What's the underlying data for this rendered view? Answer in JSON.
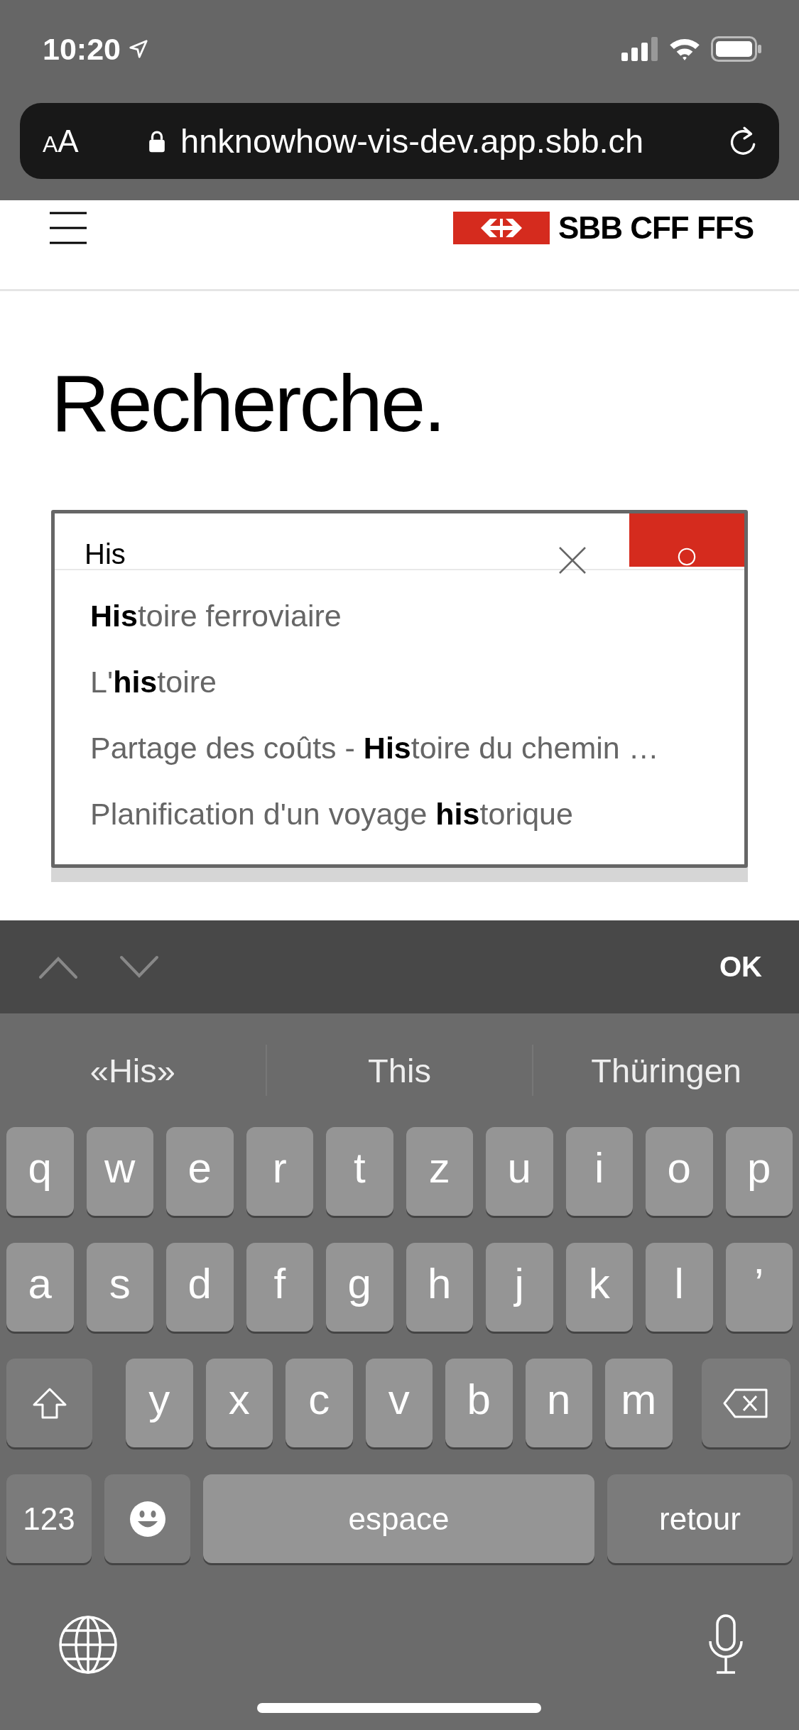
{
  "status_bar": {
    "time": "10:20"
  },
  "browser": {
    "text_size": {
      "small": "A",
      "large": "A"
    },
    "url": "hnknowhow-vis-dev.app.sbb.ch"
  },
  "header": {
    "logo_text": "SBB CFF FFS"
  },
  "page_title": "Recherche.",
  "search": {
    "value": "His",
    "suggestions": [
      {
        "text": "**His**toire ferroviaire"
      },
      {
        "text": "L'**his**toire"
      },
      {
        "text": "Partage des coûts - **His**toire du chemin …"
      },
      {
        "text": "Planification d'un voyage **his**torique"
      }
    ]
  },
  "keyboard_toolbar": {
    "done": "OK"
  },
  "keyboard": {
    "predictions": [
      "«His»",
      "This",
      "Thüringen"
    ],
    "key_rows": [
      {
        "keys": [
          {
            "kind": "letter",
            "label": "q"
          },
          {
            "kind": "letter",
            "label": "w"
          },
          {
            "kind": "letter",
            "label": "e"
          },
          {
            "kind": "letter",
            "label": "r"
          },
          {
            "kind": "letter",
            "label": "t"
          },
          {
            "kind": "letter",
            "label": "z"
          },
          {
            "kind": "letter",
            "label": "u"
          },
          {
            "kind": "letter",
            "label": "i"
          },
          {
            "kind": "letter",
            "label": "o"
          },
          {
            "kind": "letter",
            "label": "p"
          }
        ]
      },
      {
        "keys": [
          {
            "kind": "letter",
            "label": "a"
          },
          {
            "kind": "letter",
            "label": "s"
          },
          {
            "kind": "letter",
            "label": "d"
          },
          {
            "kind": "letter",
            "label": "f"
          },
          {
            "kind": "letter",
            "label": "g"
          },
          {
            "kind": "letter",
            "label": "h"
          },
          {
            "kind": "letter",
            "label": "j"
          },
          {
            "kind": "letter",
            "label": "k"
          },
          {
            "kind": "letter",
            "label": "l"
          },
          {
            "kind": "letter",
            "label": "’"
          }
        ]
      },
      {
        "keys": [
          {
            "kind": "shift"
          },
          {
            "kind": "letter",
            "label": "y"
          },
          {
            "kind": "letter",
            "label": "x"
          },
          {
            "kind": "letter",
            "label": "c"
          },
          {
            "kind": "letter",
            "label": "v"
          },
          {
            "kind": "letter",
            "label": "b"
          },
          {
            "kind": "letter",
            "label": "n"
          },
          {
            "kind": "letter",
            "label": "m"
          },
          {
            "kind": "backspace"
          }
        ]
      },
      {
        "keys": [
          {
            "kind": "numbers",
            "label": "123"
          },
          {
            "kind": "emoji"
          },
          {
            "kind": "space",
            "label": "espace"
          },
          {
            "kind": "return",
            "label": "retour"
          }
        ]
      }
    ]
  }
}
